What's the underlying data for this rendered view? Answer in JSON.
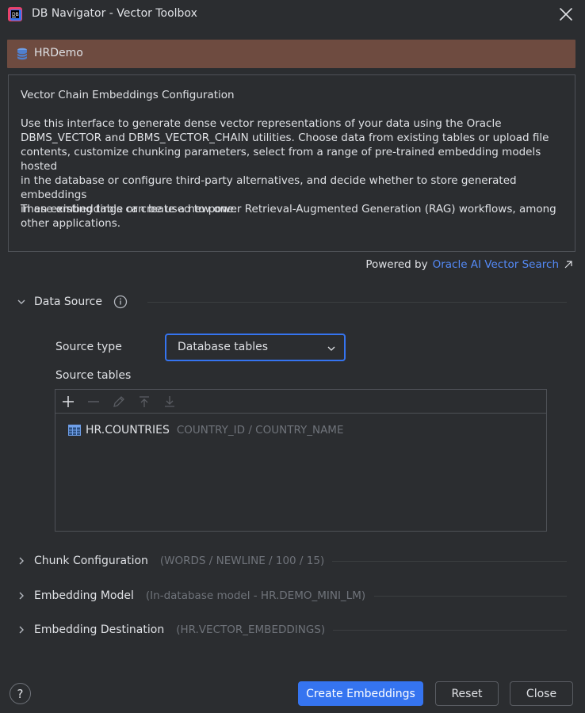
{
  "window": {
    "title": "DB Navigator - Vector Toolbox"
  },
  "connection": {
    "name": "HRDemo",
    "bar_color": "#6e4b40"
  },
  "intro": {
    "title": "Vector Chain Embeddings Configuration",
    "paragraph1": "Use this interface to generate dense vector representations of your data using the Oracle\nDBMS_VECTOR and DBMS_VECTOR_CHAIN utilities. Choose data from existing tables or upload file\ncontents, customize chunking parameters, select from a range of pre-trained embedding models hosted\nin the database or configure third-party alternatives, and decide whether to store generated embeddings\nin an existing table or create a new one.",
    "paragraph2": "These embeddings can be used to power Retrieval-Augmented Generation (RAG) workflows, among\nother applications."
  },
  "powered_by": {
    "label": "Powered by",
    "link": "Oracle AI Vector Search"
  },
  "data_source": {
    "title": "Data Source",
    "expanded": true,
    "source_type_label": "Source type",
    "source_type_value": "Database tables",
    "source_tables_label": "Source tables",
    "tables": [
      {
        "name": "HR.COUNTRIES",
        "columns": "COUNTRY_ID / COUNTRY_NAME"
      }
    ]
  },
  "sections": [
    {
      "title": "Chunk Configuration",
      "summary": "(WORDS / NEWLINE / 100 / 15)"
    },
    {
      "title": "Embedding Model",
      "summary": "(In-database model - HR.DEMO_MINI_LM)"
    },
    {
      "title": "Embedding Destination",
      "summary": "(HR.VECTOR_EMBEDDINGS)"
    }
  ],
  "buttons": {
    "help": "?",
    "create": "Create Embeddings",
    "reset": "Reset",
    "close": "Close"
  },
  "colors": {
    "accent": "#3574f0",
    "link": "#548af7",
    "background": "#2b2d30"
  }
}
